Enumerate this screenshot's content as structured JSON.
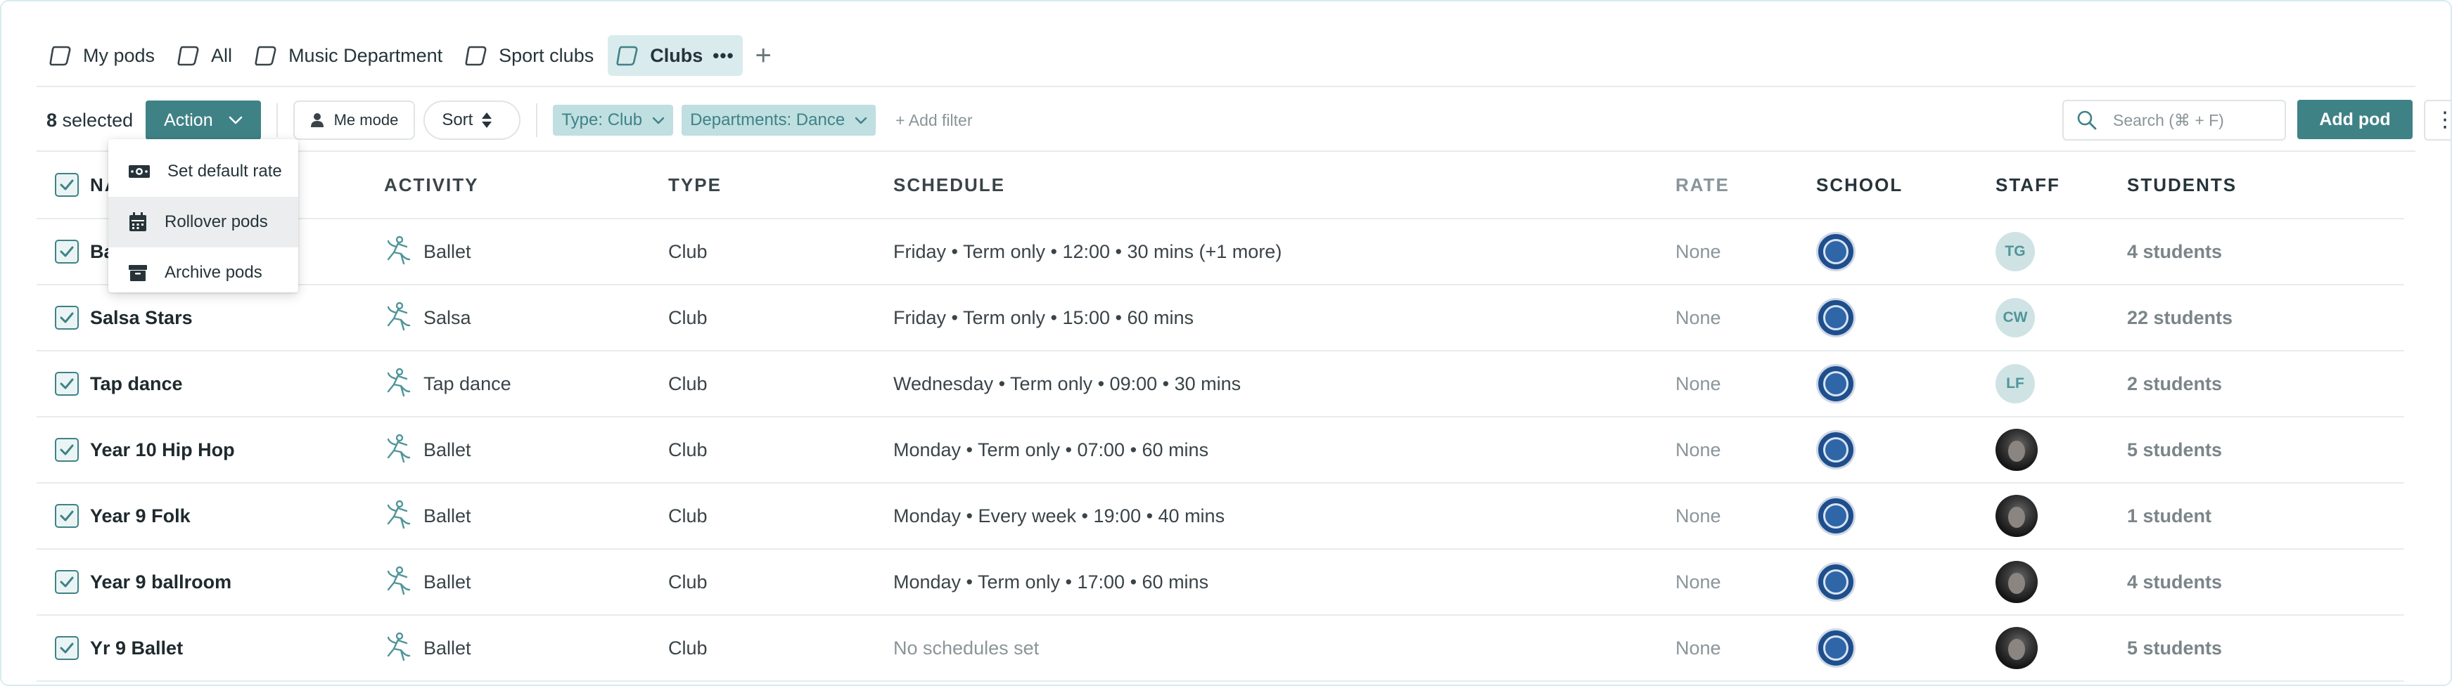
{
  "tabs": [
    {
      "label": "My pods",
      "active": false
    },
    {
      "label": "All",
      "active": false
    },
    {
      "label": "Music Department",
      "active": false
    },
    {
      "label": "Sport clubs",
      "active": false
    },
    {
      "label": "Clubs",
      "active": true
    }
  ],
  "tab_more": "•••",
  "tab_add": "+",
  "toolbar": {
    "selected_count": "8",
    "selected_text": " selected",
    "action_label": "Action",
    "me_mode_label": "Me mode",
    "sort_label": "Sort",
    "filters": [
      "Type: Club",
      "Departments: Dance"
    ],
    "add_filter": "+ Add filter",
    "search_placeholder": "Search (⌘ + F)",
    "add_pod_label": "Add pod",
    "kebab": "⋮"
  },
  "menu": {
    "items": [
      {
        "label": "Set default rate",
        "icon": "money-icon"
      },
      {
        "label": "Rollover pods",
        "icon": "calendar-icon"
      },
      {
        "label": "Archive pods",
        "icon": "archive-icon"
      }
    ]
  },
  "table": {
    "columns": [
      "NAME",
      "ACTIVITY",
      "TYPE",
      "SCHEDULE",
      "RATE",
      "SCHOOL",
      "STAFF",
      "STUDENTS"
    ],
    "rows": [
      {
        "name": "Ballet",
        "activity": "Ballet",
        "type": "Club",
        "schedule": "Friday • Term only • 12:00 • 30 mins (+1 more)",
        "rate": "None",
        "staff": "TG",
        "staff_photo": false,
        "students": "4 students"
      },
      {
        "name": "Salsa Stars",
        "activity": "Salsa",
        "type": "Club",
        "schedule": "Friday • Term only • 15:00 • 60 mins",
        "rate": "None",
        "staff": "CW",
        "staff_photo": false,
        "students": "22 students"
      },
      {
        "name": "Tap dance",
        "activity": "Tap dance",
        "type": "Club",
        "schedule": "Wednesday • Term only • 09:00 • 30 mins",
        "rate": "None",
        "staff": "LF",
        "staff_photo": false,
        "students": "2 students"
      },
      {
        "name": "Year 10 Hip Hop",
        "activity": "Ballet",
        "type": "Club",
        "schedule": "Monday • Term only • 07:00 • 60 mins",
        "rate": "None",
        "staff": "",
        "staff_photo": true,
        "students": "5 students"
      },
      {
        "name": "Year 9 Folk",
        "activity": "Ballet",
        "type": "Club",
        "schedule": "Monday • Every week • 19:00 • 40 mins",
        "rate": "None",
        "staff": "",
        "staff_photo": true,
        "students": "1 student"
      },
      {
        "name": "Year 9 ballroom",
        "activity": "Ballet",
        "type": "Club",
        "schedule": "Monday • Term only • 17:00 • 60 mins",
        "rate": "None",
        "staff": "",
        "staff_photo": true,
        "students": "4 students"
      },
      {
        "name": "Yr 9 Ballet",
        "activity": "Ballet",
        "type": "Club",
        "schedule": "No schedules set",
        "schedule_muted": true,
        "rate": "None",
        "staff": "",
        "staff_photo": true,
        "students": "5 students"
      }
    ]
  },
  "colors": {
    "accent": "#3f8286",
    "chip_bg": "#bfdfe1",
    "tab_active_bg": "#d9ebed"
  }
}
